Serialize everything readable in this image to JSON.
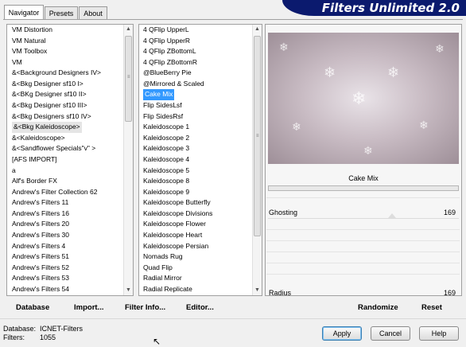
{
  "tabs": [
    {
      "label": "Navigator",
      "active": true
    },
    {
      "label": "Presets",
      "active": false
    },
    {
      "label": "About",
      "active": false
    }
  ],
  "banner_title": "Filters Unlimited 2.0",
  "categories": [
    "VM Distortion",
    "VM Natural",
    "VM Toolbox",
    "VM",
    "&<Background Designers IV>",
    "&<Bkg Designer sf10 I>",
    "&<BKg Designer sf10 II>",
    "&<Bkg Designer sf10 III>",
    "&<Bkg Designers sf10 IV>",
    "&<Bkg Kaleidoscope>",
    "&<Kaleidoscope>",
    "&<Sandflower Specials\"v\" >",
    "[AFS IMPORT]",
    "a",
    "Alf's Border FX",
    "Andrew's Filter Collection 62",
    "Andrew's Filters 11",
    "Andrew's Filters 16",
    "Andrew's Filters 20",
    "Andrew's Filters 30",
    "Andrew's Filters 4",
    "Andrew's Filters 51",
    "Andrew's Filters 52",
    "Andrew's Filters 53",
    "Andrew's Filters 54"
  ],
  "categories_hovered": "&<Bkg Kaleidoscope>",
  "filters": [
    "4 QFlip UpperL",
    "4 QFlip UpperR",
    "4 QFlip ZBottomL",
    "4 QFlip ZBottomR",
    "@BlueBerry Pie",
    "@Mirrored & Scaled",
    "Cake Mix",
    "Flip SidesLsf",
    "Flip SidesRsf",
    "Kaleidoscope 1",
    "Kaleidoscope 2",
    "Kaleidoscope 3",
    "Kaleidoscope 4",
    "Kaleidoscope 5",
    "Kaleidoscope 8",
    "Kaleidoscope 9",
    "Kaleidoscope Butterfly",
    "Kaleidoscope Divisions",
    "Kaleidoscope Flower",
    "Kaleidoscope Heart",
    "Kaleidoscope Persian",
    "Nomads Rug",
    "Quad Flip",
    "Radial Mirror",
    "Radial Replicate"
  ],
  "filters_selected": "Cake Mix",
  "preview_filter_name": "Cake Mix",
  "params": [
    {
      "label": "Ghosting",
      "value": "169"
    },
    {
      "label": "Radius",
      "value": "169"
    }
  ],
  "links": {
    "database": "Database",
    "import": "Import...",
    "filter_info": "Filter Info...",
    "editor": "Editor...",
    "randomize": "Randomize",
    "reset": "Reset"
  },
  "status": {
    "database_label": "Database:",
    "database_value": "ICNET-Filters",
    "filters_label": "Filters:",
    "filters_value": "1055"
  },
  "buttons": {
    "apply": "Apply",
    "cancel": "Cancel",
    "help": "Help"
  },
  "colors": {
    "banner": "#0b1a6e",
    "selection": "#3399ff"
  }
}
